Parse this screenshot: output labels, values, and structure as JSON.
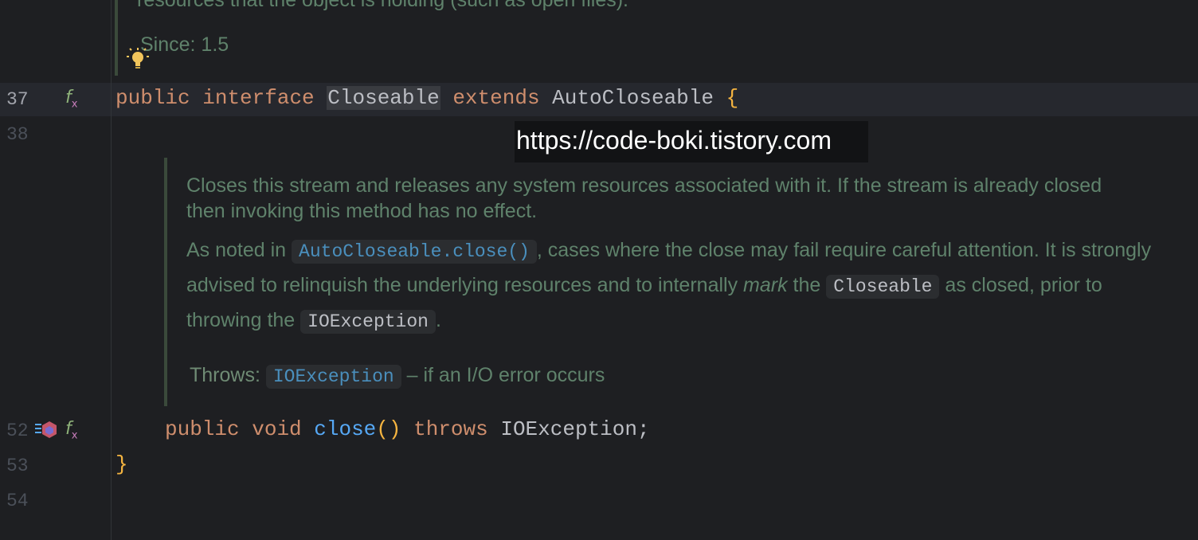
{
  "doc_top": {
    "truncated_text": "resources that the object is holding (such as open files).",
    "since": "Since: 1.5"
  },
  "gutter": {
    "line_numbers": [
      "37",
      "38",
      "52",
      "53",
      "54"
    ]
  },
  "code": {
    "line37": {
      "kw1": "public",
      "kw2": "interface",
      "name": "Closeable",
      "kw3": "extends",
      "super": "AutoCloseable",
      "brace": "{"
    },
    "line52": {
      "kw1": "public",
      "kw2": "void",
      "method": "close",
      "parens": "()",
      "kw3": "throws",
      "exc": "IOException;"
    },
    "line53": {
      "brace": "}"
    }
  },
  "doc": {
    "para1": "Closes this stream and releases any system resources associated with it. If the stream is already closed then invoking this method has no effect.",
    "para2": {
      "t1": "As noted in ",
      "link": "AutoCloseable.close()",
      "t2": ", cases where the close may fail require careful attention. It is strongly advised to relinquish the underlying resources and to internally ",
      "mark": "mark",
      "t3": " the ",
      "chip1": "Closeable",
      "t4": " as closed, prior to throwing the ",
      "chip2": "IOException",
      "t5": "."
    },
    "throws": {
      "label": "Throws:",
      "link": "IOException",
      "desc": " – if an I/O error occurs"
    }
  },
  "watermark": "https://code-boki.tistory.com",
  "icons": {
    "gutter_37": "method-impl-icon",
    "gutter_52_a": "implementation-icon",
    "gutter_52_b": "method-impl-icon",
    "bulb": "lightbulb-icon"
  },
  "colors": {
    "background": "#1e1f22",
    "keyword": "#cf8e6d",
    "function": "#56a8f5",
    "doc_text": "#5f826b",
    "link": "#4a8fbd",
    "brace": "#f5b440"
  }
}
